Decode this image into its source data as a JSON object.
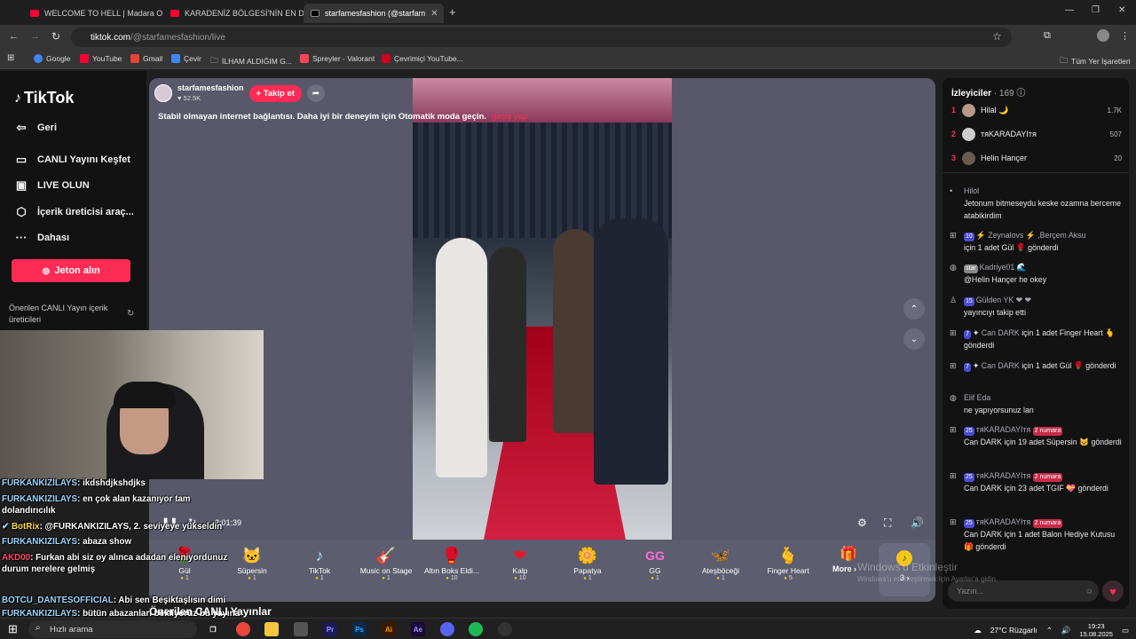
{
  "browser": {
    "tabs": [
      {
        "label": "WELCOME TO HELL | Madara O",
        "favicon": "youtube-icon"
      },
      {
        "label": "KARADENİZ BÖLGESİ'NİN EN D",
        "favicon": "youtube-icon"
      },
      {
        "label": "starfamesfashion (@starfam",
        "favicon": "tiktok-icon"
      }
    ],
    "url_host": "tiktok.com",
    "url_path": "/@starfamesfashion/live",
    "bookmarks": [
      "Google",
      "YouTube",
      "Gmail",
      "Çevir",
      "İLHAM ALDIĞIM G...",
      "Spreyler - Valorant",
      "Çevrimiçi YouTube..."
    ],
    "all_bookmarks": "Tüm Yer İşaretleri"
  },
  "sidebar": {
    "logo": "TikTok",
    "items": [
      {
        "label": "Geri",
        "icon": "arrow-left-icon"
      },
      {
        "label": "CANLI Yayını Keşfet",
        "icon": "live-explore-icon"
      },
      {
        "label": "LIVE OLUN",
        "icon": "camera-icon"
      },
      {
        "label": "İçerik üreticisi araç...",
        "icon": "creator-tools-icon"
      },
      {
        "label": "Dahası",
        "icon": "more-icon"
      }
    ],
    "coin_button": "Jeton alın",
    "suggested": "Önerilen CANLI Yayın içerik üreticileri"
  },
  "stream": {
    "username": "starfamesfashion",
    "likes": "52.5K",
    "follow": "+ Takip et",
    "banner": "Stabil olmayan internet bağlantısı. Daha iyi bir deneyim için Otomatik moda geçin.",
    "banner_link": "geçiş yap",
    "timer": "2:01:39",
    "gifts": [
      {
        "name": "Gül",
        "price": "1",
        "icon": "🌹"
      },
      {
        "name": "Süpersin",
        "price": "1",
        "icon": "🐱"
      },
      {
        "name": "TikTok",
        "price": "1",
        "icon": "♪"
      },
      {
        "name": "Music on Stage",
        "price": "1",
        "icon": "🎸"
      },
      {
        "name": "Altın Boks Eldi...",
        "price": "10",
        "icon": "🥊"
      },
      {
        "name": "Kalp",
        "price": "10",
        "icon": "❤"
      },
      {
        "name": "Papatya",
        "price": "1",
        "icon": "🌼"
      },
      {
        "name": "GG",
        "price": "1",
        "icon": "GG"
      },
      {
        "name": "Ateşböceği",
        "price": "1",
        "icon": "🦋"
      },
      {
        "name": "Finger Heart",
        "price": "5",
        "icon": "🫰"
      }
    ],
    "more": "More ›",
    "coin_count": "3 ›"
  },
  "viewers": {
    "title": "İzleyiciler",
    "count": "· 169",
    "top": [
      {
        "rank": "1",
        "name": "Hilal 🌙",
        "score": "1.7K"
      },
      {
        "rank": "2",
        "name": "тяKARADAYIтя",
        "score": "507"
      },
      {
        "rank": "3",
        "name": "Helin Hançer",
        "score": "20"
      }
    ]
  },
  "chat": [
    {
      "icon": "",
      "name": "Hilol",
      "text": "Jetonum bitmeseydu keske ozamna berceme atabikirdim"
    },
    {
      "icon": "gift",
      "badge": "10",
      "name": "⚡ Zeynalovs ⚡ ,Berçem Aksu",
      "text": "için 1 adet Gül 🌹 gönderdi"
    },
    {
      "icon": "user",
      "badge": "star",
      "name": "Kadriye01 🌊",
      "text": "@Helin Hançer he okey"
    },
    {
      "icon": "follow",
      "badge": "15",
      "name": "Gülden YK ❤ ❤",
      "text": "yayıncıyı takip etti"
    },
    {
      "icon": "gift",
      "badge": "7",
      "name": "Can DARK",
      "text": "için 1 adet Finger Heart 🫰 gönderdi"
    },
    {
      "icon": "gift",
      "badge": "7",
      "name": "Can DARK",
      "text": "için 1 adet Gül 🌹 gönderdi"
    },
    {
      "icon": "user",
      "badge": "",
      "name": "Elif Eda",
      "text": "ne yapıyorsunuz lan"
    },
    {
      "icon": "gift",
      "badge": "25",
      "name": "тяKARADAYIтя",
      "extra": "2 numara",
      "text": "Can DARK için 19 adet Süpersin 🐱 gönderdi"
    },
    {
      "icon": "gift",
      "badge": "25",
      "name": "тяKARADAYIтя",
      "extra": "2 numara",
      "text": "Can DARK için 23 adet TGIF 💝 gönderdi"
    },
    {
      "icon": "gift",
      "badge": "25",
      "name": "тяKARADAYIтя",
      "extra": "2 numara",
      "text": "Can DARK için 1 adet Balon Hediye Kutusu 🎁 gönderdi"
    }
  ],
  "chat_input": "Yazın...",
  "windows": {
    "activate_title": "Windows'u Etkinleştir",
    "activate_sub": "Windows'u etkinleştirmek için Ayarlar'a gidin."
  },
  "overlay_chat": [
    {
      "name": "FURKANKIZILAYS",
      "text": ": ikdshdjkshdjks",
      "red": false
    },
    {
      "name": "FURKANKIZILAYS",
      "text": ": en çok alan kazanıyor tam dolandırıcılık",
      "red": false
    },
    {
      "name": "BotRix",
      "text": ": @FURKANKIZILAYS, 2. seviyeye yükseldin",
      "red": false
    },
    {
      "name": "FURKANKIZILAYS",
      "text": ": abaza show",
      "red": false
    },
    {
      "name": "AKD00",
      "text": ": Furkan abi siz oy alınca adadan eleniyordunuz durum nerelere gelmiş",
      "red": true
    },
    {
      "name": "BOTCU_DANTESOFFICIAL",
      "text": ": Abi sen Beşiktaşlısın dimi",
      "red": false
    },
    {
      "name": "FURKANKIZILAYS",
      "text": ": bütün abazanları bekliyoruz bu yayına",
      "red": false
    }
  ],
  "bottom_title": "Önerilen CANLI Yayınlar",
  "taskbar": {
    "search": "Hızlı arama",
    "weather": "27°C Rüzgarlı",
    "time": "19:23",
    "date": "15.08.2025"
  }
}
